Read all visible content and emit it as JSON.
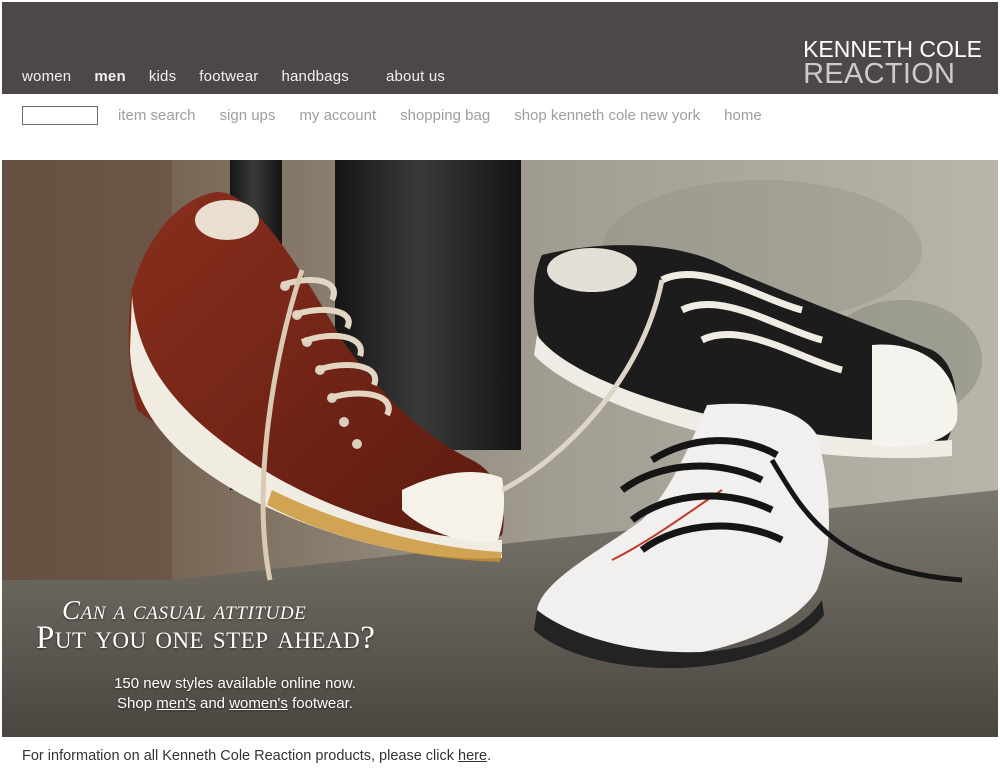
{
  "nav": {
    "main": [
      "women",
      "men",
      "kids",
      "footwear",
      "handbags",
      "about us"
    ],
    "active": "men"
  },
  "logo": {
    "line1": "KENNETH COLE",
    "line2": "REACTION"
  },
  "subnav": {
    "search_value": "",
    "links": [
      "item search",
      "sign ups",
      "my account",
      "shopping bag",
      "shop kenneth cole new york",
      "home"
    ]
  },
  "hero": {
    "headline_line1": "Can a casual attitude",
    "headline_line2": "Put you one step ahead?",
    "tagline_line1": "150 new styles available online now.",
    "tagline_shop": "Shop",
    "tagline_mens": "men's",
    "tagline_and": "and",
    "tagline_womens": "women's",
    "tagline_end": "footwear."
  },
  "footer": {
    "text": "For information on all Kenneth Cole Reaction products, please click",
    "link": "here",
    "end": "."
  },
  "colors": {
    "topbar": "#4d4747",
    "subnav_text": "#9d9d9d",
    "brown_shoe": "#7a2a1a",
    "black_shoe": "#1a1a1a"
  }
}
